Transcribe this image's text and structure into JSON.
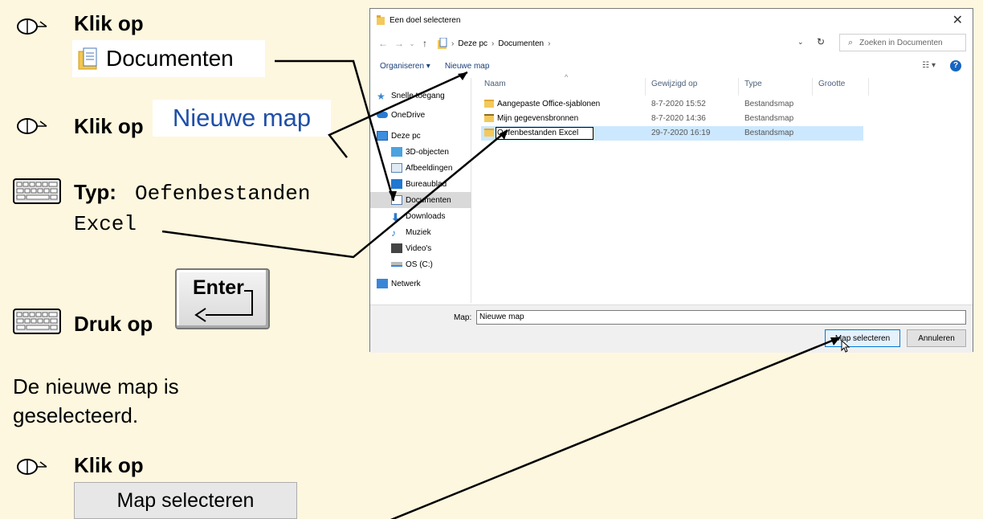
{
  "instructions": {
    "step1_label": "Klik op",
    "step1_target": "Documenten",
    "step2_label": "Klik op",
    "step2_target": "Nieuwe map",
    "step3_label": "Typ:",
    "step3_text_line1": "Oefenbestanden",
    "step3_text_line2": "Excel",
    "step4_label": "Druk op",
    "step4_key": "Enter",
    "result_line1": "De nieuwe map is",
    "result_line2": "geselecteerd.",
    "step5_label": "Klik op",
    "step5_target": "Map selecteren"
  },
  "dialog": {
    "title": "Een doel selecteren",
    "breadcrumb": [
      "Deze pc",
      "Documenten"
    ],
    "search_placeholder": "Zoeken in Documenten",
    "toolbar": {
      "organize": "Organiseren ▾",
      "new_folder": "Nieuwe map"
    },
    "nav_items": [
      "Snelle toegang",
      "OneDrive",
      "Deze pc",
      "3D-objecten",
      "Afbeeldingen",
      "Bureaublad",
      "Documenten",
      "Downloads",
      "Muziek",
      "Video's",
      "OS (C:)",
      "Netwerk"
    ],
    "columns": {
      "name": "Naam",
      "modified": "Gewijzigd op",
      "type": "Type",
      "size": "Grootte"
    },
    "rows": [
      {
        "name": "Aangepaste Office-sjablonen",
        "modified": "8-7-2020 15:52",
        "type": "Bestandsmap"
      },
      {
        "name": "Mijn gegevensbronnen",
        "modified": "8-7-2020 14:36",
        "type": "Bestandsmap"
      },
      {
        "name": "Oefenbestanden Excel",
        "modified": "29-7-2020 16:19",
        "type": "Bestandsmap"
      }
    ],
    "folder_label": "Map:",
    "folder_value": "Nieuwe map",
    "select_button": "Map selecteren",
    "cancel_button": "Annuleren"
  },
  "colors": {
    "page_bg": "#fdf7df",
    "selection": "#cce8ff",
    "accent": "#0078d7",
    "link": "#1f4fa8"
  }
}
